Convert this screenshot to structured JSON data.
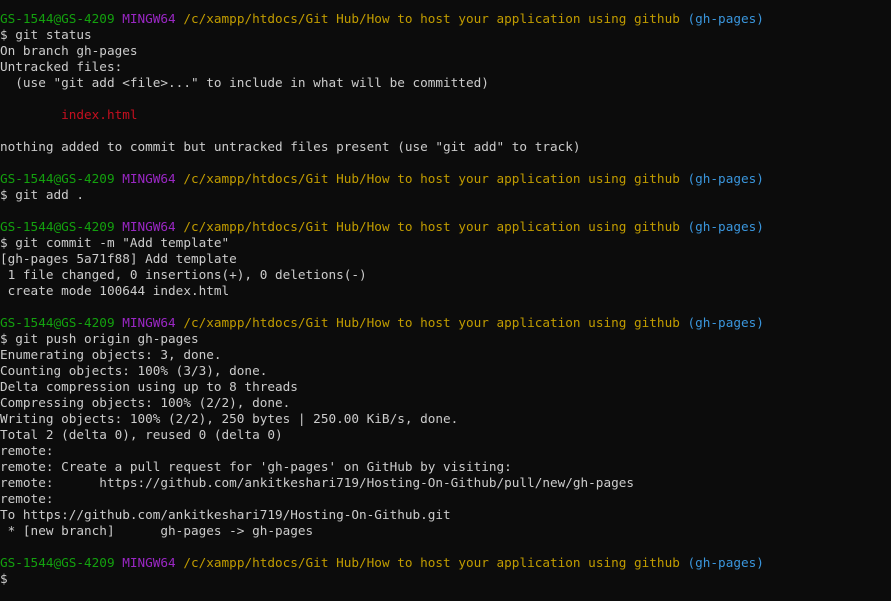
{
  "terminal": {
    "lines": [
      {
        "type": "prompt",
        "user": "GS-1544@GS-4209",
        "env": "MINGW64",
        "path": "/c/xampp/htdocs/Git Hub/How to host your application using github",
        "branch": "(gh-pages)"
      },
      {
        "type": "text",
        "text": "$ git status"
      },
      {
        "type": "text",
        "text": "On branch gh-pages"
      },
      {
        "type": "text",
        "text": "Untracked files:"
      },
      {
        "type": "text",
        "text": "  (use \"git add <file>...\" to include in what will be committed)"
      },
      {
        "type": "text",
        "text": ""
      },
      {
        "type": "untracked",
        "text": "        index.html"
      },
      {
        "type": "text",
        "text": ""
      },
      {
        "type": "text",
        "text": "nothing added to commit but untracked files present (use \"git add\" to track)"
      },
      {
        "type": "text",
        "text": ""
      },
      {
        "type": "prompt",
        "user": "GS-1544@GS-4209",
        "env": "MINGW64",
        "path": "/c/xampp/htdocs/Git Hub/How to host your application using github",
        "branch": "(gh-pages)"
      },
      {
        "type": "text",
        "text": "$ git add ."
      },
      {
        "type": "text",
        "text": ""
      },
      {
        "type": "prompt",
        "user": "GS-1544@GS-4209",
        "env": "MINGW64",
        "path": "/c/xampp/htdocs/Git Hub/How to host your application using github",
        "branch": "(gh-pages)"
      },
      {
        "type": "text",
        "text": "$ git commit -m \"Add template\""
      },
      {
        "type": "text",
        "text": "[gh-pages 5a71f88] Add template"
      },
      {
        "type": "text",
        "text": " 1 file changed, 0 insertions(+), 0 deletions(-)"
      },
      {
        "type": "text",
        "text": " create mode 100644 index.html"
      },
      {
        "type": "text",
        "text": ""
      },
      {
        "type": "prompt",
        "user": "GS-1544@GS-4209",
        "env": "MINGW64",
        "path": "/c/xampp/htdocs/Git Hub/How to host your application using github",
        "branch": "(gh-pages)"
      },
      {
        "type": "text",
        "text": "$ git push origin gh-pages"
      },
      {
        "type": "text",
        "text": "Enumerating objects: 3, done."
      },
      {
        "type": "text",
        "text": "Counting objects: 100% (3/3), done."
      },
      {
        "type": "text",
        "text": "Delta compression using up to 8 threads"
      },
      {
        "type": "text",
        "text": "Compressing objects: 100% (2/2), done."
      },
      {
        "type": "text",
        "text": "Writing objects: 100% (2/2), 250 bytes | 250.00 KiB/s, done."
      },
      {
        "type": "text",
        "text": "Total 2 (delta 0), reused 0 (delta 0)"
      },
      {
        "type": "text",
        "text": "remote:"
      },
      {
        "type": "text",
        "text": "remote: Create a pull request for 'gh-pages' on GitHub by visiting:"
      },
      {
        "type": "text",
        "text": "remote:      https://github.com/ankitkeshari719/Hosting-On-Github/pull/new/gh-pages"
      },
      {
        "type": "text",
        "text": "remote:"
      },
      {
        "type": "text",
        "text": "To https://github.com/ankitkeshari719/Hosting-On-Github.git"
      },
      {
        "type": "text",
        "text": " * [new branch]      gh-pages -> gh-pages"
      },
      {
        "type": "text",
        "text": ""
      },
      {
        "type": "prompt",
        "user": "GS-1544@GS-4209",
        "env": "MINGW64",
        "path": "/c/xampp/htdocs/Git Hub/How to host your application using github",
        "branch": "(gh-pages)"
      },
      {
        "type": "text",
        "text": "$"
      }
    ]
  },
  "colors": {
    "background": "#0c0c0c",
    "text": "#cccccc",
    "user": "#13a10e",
    "env": "#9a27c4",
    "path": "#c19c00",
    "branch": "#3a96dd",
    "untracked": "#c50f1f"
  }
}
